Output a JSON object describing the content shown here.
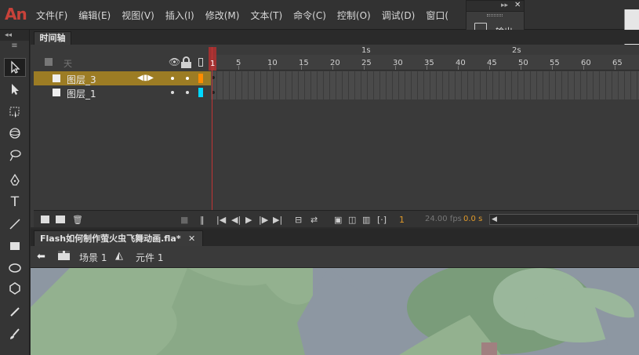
{
  "app": {
    "logo": "An"
  },
  "menu": [
    "文件(F)",
    "编辑(E)",
    "视图(V)",
    "插入(I)",
    "修改(M)",
    "文本(T)",
    "命令(C)",
    "控制(O)",
    "调试(D)",
    "窗口("
  ],
  "output_panel": {
    "label": "输出",
    "icon": "output-icon"
  },
  "timeline": {
    "tab_label": "时间轴",
    "header_folder": "天",
    "ruler_numbers": [
      "1",
      "5",
      "10",
      "15",
      "20",
      "25",
      "30",
      "35",
      "40",
      "45",
      "50",
      "55",
      "60",
      "65"
    ],
    "ruler_seconds": [
      "1s",
      "2s"
    ],
    "layers": [
      {
        "name": "图层_3",
        "selected": true,
        "color": "#ff8c00"
      },
      {
        "name": "图层_1",
        "selected": false,
        "color": "#00d8ff"
      }
    ],
    "footer": {
      "frame": "1",
      "fps": "24.00 fps",
      "time": "0.0 s"
    }
  },
  "document": {
    "tab_title": "Flash如何制作萤火虫飞舞动画.fla*",
    "breadcrumb": [
      {
        "label": "场景 1"
      },
      {
        "label": "元件 1"
      }
    ]
  },
  "colors": {
    "accent": "#c23535",
    "layer_selected": "#b08a2a",
    "stage_bg": "#8c96a0",
    "tree": "#98b698"
  }
}
